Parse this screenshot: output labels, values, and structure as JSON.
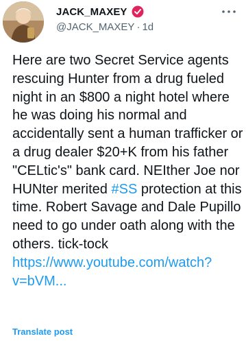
{
  "post": {
    "author": {
      "display_name": "JACK_MAXEY",
      "handle": "@JACK_MAXEY",
      "separator": "·",
      "time": "1d",
      "verified_badge_icon": "red-verified-badge-icon",
      "badge_color": "#e0245e"
    },
    "more_icon": "more-dots-icon",
    "text_parts": {
      "p1": "Here are two Secret Service agents rescuing Hunter from a drug fueled night in an $800 a night hotel where he was doing his normal and accidentally sent a human trafficker or a drug dealer $20+K from his father \"CELtic's\" bank card. NEIther Joe nor HUNter merited ",
      "hashtag": "#SS",
      "p2": " protection at this time. Robert Savage and Dale Pupillo need to go under oath along with the others. tick-tock ",
      "link": "https://www.youtube.com/watch?v=bVM..."
    },
    "translate_label": "Translate post"
  },
  "colors": {
    "link": "#1d9bf0",
    "text": "#0f1419",
    "muted": "#536471"
  }
}
